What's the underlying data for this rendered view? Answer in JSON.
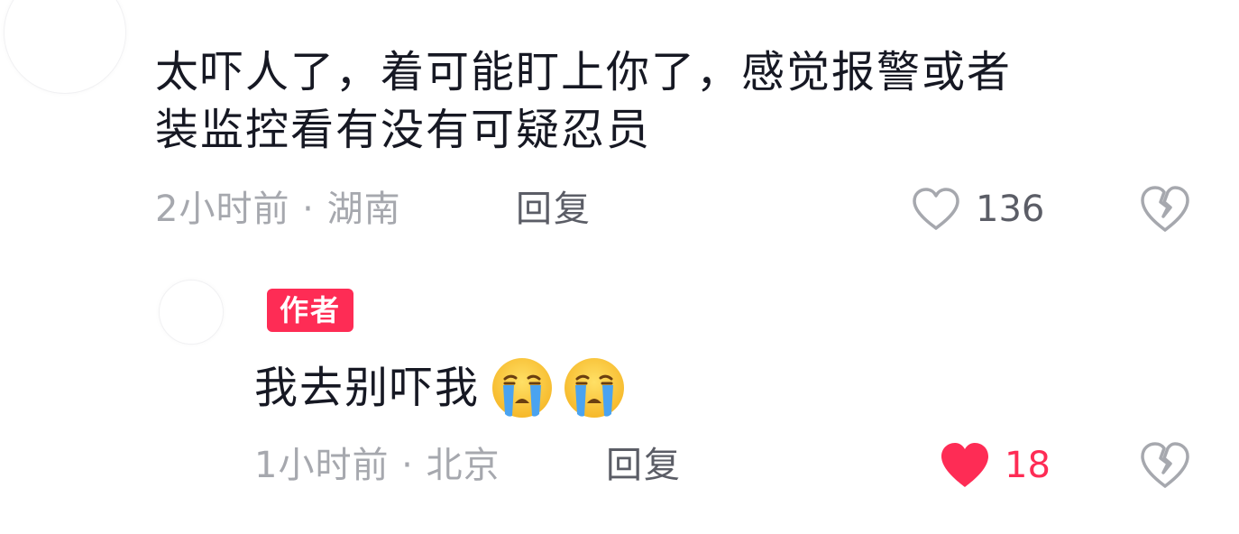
{
  "main_comment": {
    "text_lines": [
      "太吓人了，着可能盯上你了，感觉报警或者",
      "装监控看有没有可疑忍员"
    ],
    "meta": "2小时前 · 湖南",
    "reply_label": "回复",
    "like_count": "136",
    "liked": false
  },
  "reply_comment": {
    "badge": "作者",
    "text": "我去别吓我",
    "emojis": [
      "crying-face-icon",
      "crying-face-icon"
    ],
    "meta": "1小时前 · 北京",
    "reply_label": "回复",
    "like_count": "18",
    "liked": true
  },
  "colors": {
    "accent": "#fe2c55",
    "text_primary": "#161823",
    "text_meta": "#a6a8ae",
    "text_secondary": "#5b5d66"
  }
}
